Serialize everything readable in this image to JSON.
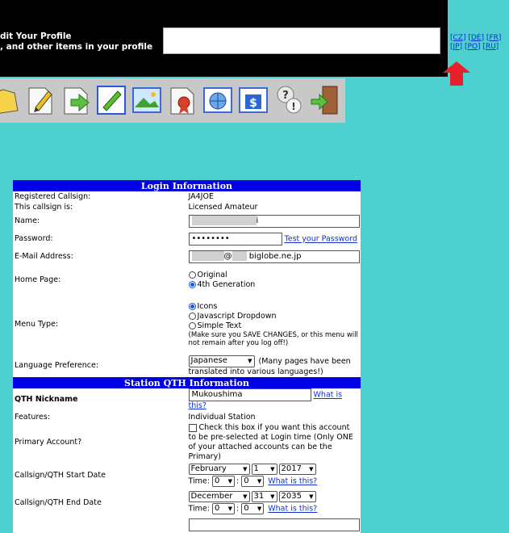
{
  "header": {
    "title_line": "dit Your Profile",
    "subtitle_line": ", and other items in your profile",
    "search_value": ""
  },
  "languages": [
    "CZ",
    "DE",
    "FR",
    "JP",
    "PO",
    "RU"
  ],
  "toolbar": {
    "icons": [
      "folder-icon",
      "edit-page-icon",
      "forward-page-icon",
      "edit-icon",
      "picture-icon",
      "award-icon",
      "globe-icon",
      "dollar-icon",
      "help-icon",
      "exit-door-icon"
    ]
  },
  "login": {
    "section_title": "Login Information",
    "callsign_label": "Registered Callsign:",
    "callsign_value": "JA4JOE",
    "status_label": "This callsign is:",
    "status_value": "Licensed Amateur",
    "name_label": "Name:",
    "name_value_tail": "i",
    "password_label": "Password:",
    "password_value": "••••••••",
    "password_link": "Test your Password",
    "email_label": "E-Mail Address:",
    "email_at": "@",
    "email_domain": "biglobe.ne.jp",
    "homepage_label": "Home Page:",
    "homepage_opt1": "Original",
    "homepage_opt2": "4th Generation",
    "menu_label": "Menu Type:",
    "menu_opt1": "Icons",
    "menu_opt2": "Javascript Dropdown",
    "menu_opt3": "Simple Text",
    "menu_note": "(Make sure you SAVE CHANGES, or this menu will not remain after you log off!)",
    "language_label": "Language Preference:",
    "language_value": "Japanese",
    "language_note": "(Many pages have been translated into various languages!)"
  },
  "qth": {
    "section_title": "Station QTH Information",
    "nickname_label": "QTH Nickname",
    "nickname_value": "Mukoushima",
    "nickname_link": "What is this?",
    "features_label": "Features:",
    "features_value": "Individual Station",
    "primary_label": "Primary Account?",
    "primary_text": "Check this box if you want this account to be pre-selected at Login time (Only ONE of your attached accounts can be the Primary)",
    "start_label": "Callsign/QTH Start Date",
    "start_month": "February",
    "start_day": "1",
    "start_year": "2017",
    "end_label": "Callsign/QTH End Date",
    "end_month": "December",
    "end_day": "31",
    "end_year": "2035",
    "time_label": "Time:",
    "time_hour": "0",
    "time_min": "0",
    "time_colon": ":",
    "time_link": "What is this?"
  },
  "colors": {
    "background": "#4dd0ce",
    "header": "#000000",
    "section_bar": "#0000e6",
    "arrow": "#e8202a",
    "link": "#1030d0"
  }
}
